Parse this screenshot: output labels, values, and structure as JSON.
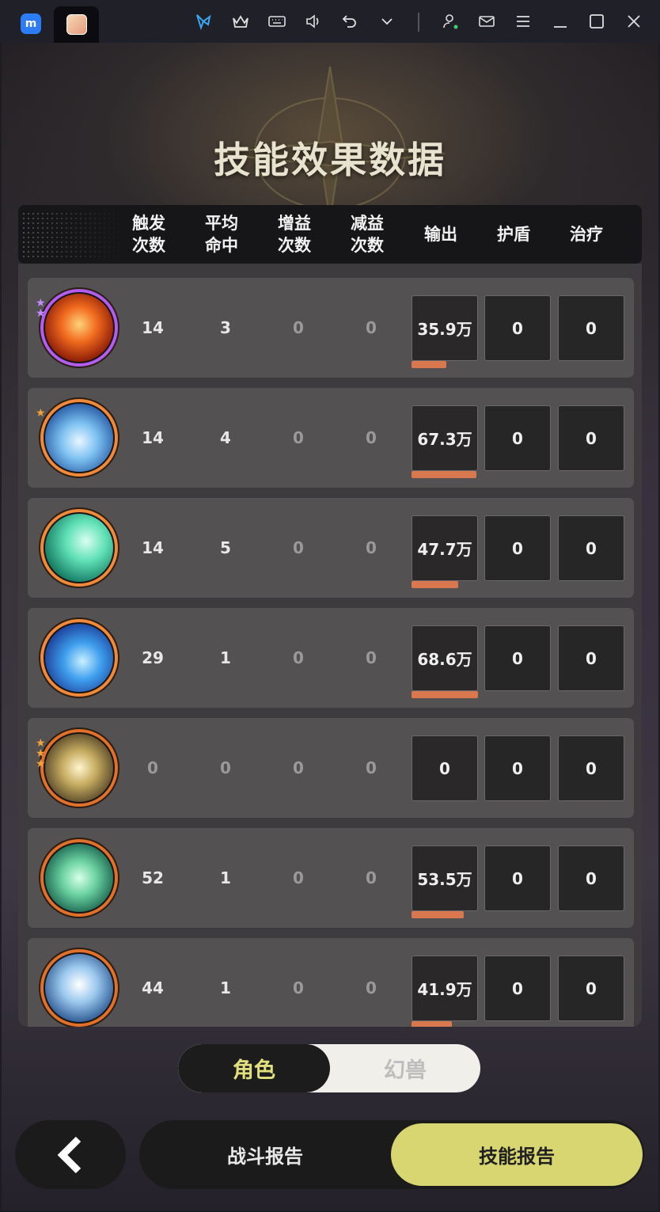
{
  "titlebar": {
    "app_logo": "m",
    "icons": [
      "butterfly-icon",
      "crown-icon",
      "keyboard-icon",
      "volume-icon",
      "undo-icon",
      "chevron-down-icon",
      "user-icon",
      "mail-icon",
      "menu-icon",
      "minimize-icon",
      "maximize-icon",
      "close-icon"
    ],
    "accent_color": "#2c7cf6"
  },
  "page": {
    "title": "技能效果数据",
    "columns": [
      "触发\n次数",
      "平均\n命中",
      "增益\n次数",
      "减益\n次数",
      "输出",
      "护盾",
      "治疗"
    ]
  },
  "rows": [
    {
      "icon": "fire-skill-icon",
      "ring": "purple",
      "stars": 2,
      "star_color": "purple",
      "trigger": "14",
      "avg_hit": "3",
      "buff": "0",
      "debuff": "0",
      "output": "35.9万",
      "output_fill": 0.52,
      "shield": "0",
      "heal": "0"
    },
    {
      "icon": "ice-burst-skill-icon",
      "ring": "orange",
      "stars": 1,
      "star_color": "orange",
      "trigger": "14",
      "avg_hit": "4",
      "buff": "0",
      "debuff": "0",
      "output": "67.3万",
      "output_fill": 0.98,
      "shield": "0",
      "heal": "0"
    },
    {
      "icon": "wind-slash-skill-icon",
      "ring": "orange",
      "stars": 0,
      "star_color": "orange",
      "trigger": "14",
      "avg_hit": "5",
      "buff": "0",
      "debuff": "0",
      "output": "47.7万",
      "output_fill": 0.7,
      "shield": "0",
      "heal": "0"
    },
    {
      "icon": "blue-flame-skill-icon",
      "ring": "orange",
      "stars": 0,
      "star_color": "orange",
      "trigger": "29",
      "avg_hit": "1",
      "buff": "0",
      "debuff": "0",
      "output": "68.6万",
      "output_fill": 1.0,
      "shield": "0",
      "heal": "0"
    },
    {
      "icon": "light-arrows-skill-icon",
      "ring": "dark-orange",
      "stars": 3,
      "star_color": "orange",
      "trigger": "0",
      "avg_hit": "0",
      "buff": "0",
      "debuff": "0",
      "output": "0",
      "output_fill": 0,
      "shield": "0",
      "heal": "0"
    },
    {
      "icon": "green-vortex-skill-icon",
      "ring": "dark-orange",
      "stars": 0,
      "star_color": "orange",
      "trigger": "52",
      "avg_hit": "1",
      "buff": "0",
      "debuff": "0",
      "output": "53.5万",
      "output_fill": 0.78,
      "shield": "0",
      "heal": "0"
    },
    {
      "icon": "ice-crystal-skill-icon",
      "ring": "dark-orange",
      "stars": 0,
      "star_color": "orange",
      "trigger": "44",
      "avg_hit": "1",
      "buff": "0",
      "debuff": "0",
      "output": "41.9万",
      "output_fill": 0.61,
      "shield": "0",
      "heal": "0"
    }
  ],
  "toggle": {
    "active": "角色",
    "inactive": "幻兽"
  },
  "footer": {
    "battle_report": "战斗报告",
    "skill_report": "技能报告"
  },
  "colors": {
    "bar": "#d9784e",
    "active_button": "#d7d670",
    "toggle_active_text": "#e2e07e"
  }
}
